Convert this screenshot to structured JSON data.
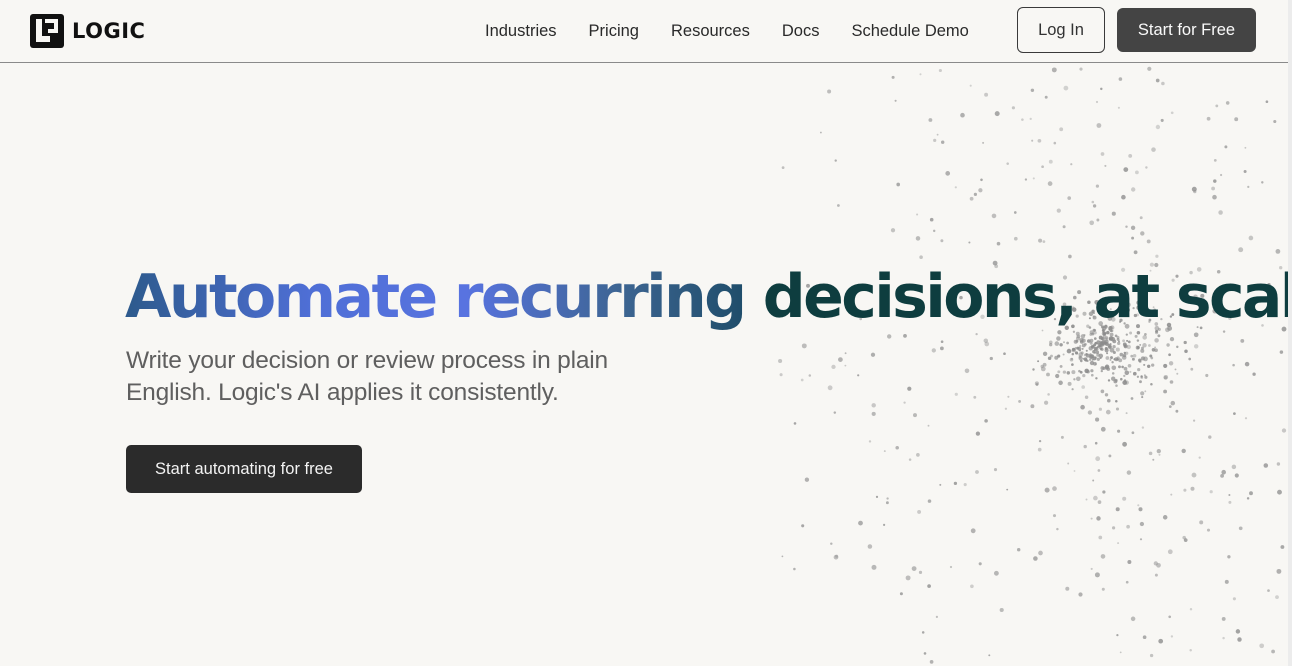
{
  "brand": {
    "name": "LOGIC"
  },
  "nav": {
    "items": [
      {
        "label": "Industries"
      },
      {
        "label": "Pricing"
      },
      {
        "label": "Resources"
      },
      {
        "label": "Docs"
      },
      {
        "label": "Schedule Demo"
      }
    ],
    "login_label": "Log In",
    "start_label": "Start for Free"
  },
  "hero": {
    "title_part1": "Automate recurring",
    "title_part2": "decisions, at scale",
    "subtitle": "Write your decision or review process in plain English. Logic's AI applies it consistently.",
    "cta_label": "Start automating for free"
  },
  "colors": {
    "background": "#f8f7f4",
    "gradient_blue": "#5873e0",
    "dark_teal": "#0e3d3f",
    "button_dark": "#2b2b2b",
    "button_gray": "#444444"
  },
  "icons": {
    "logo": "logic-logo-icon"
  }
}
